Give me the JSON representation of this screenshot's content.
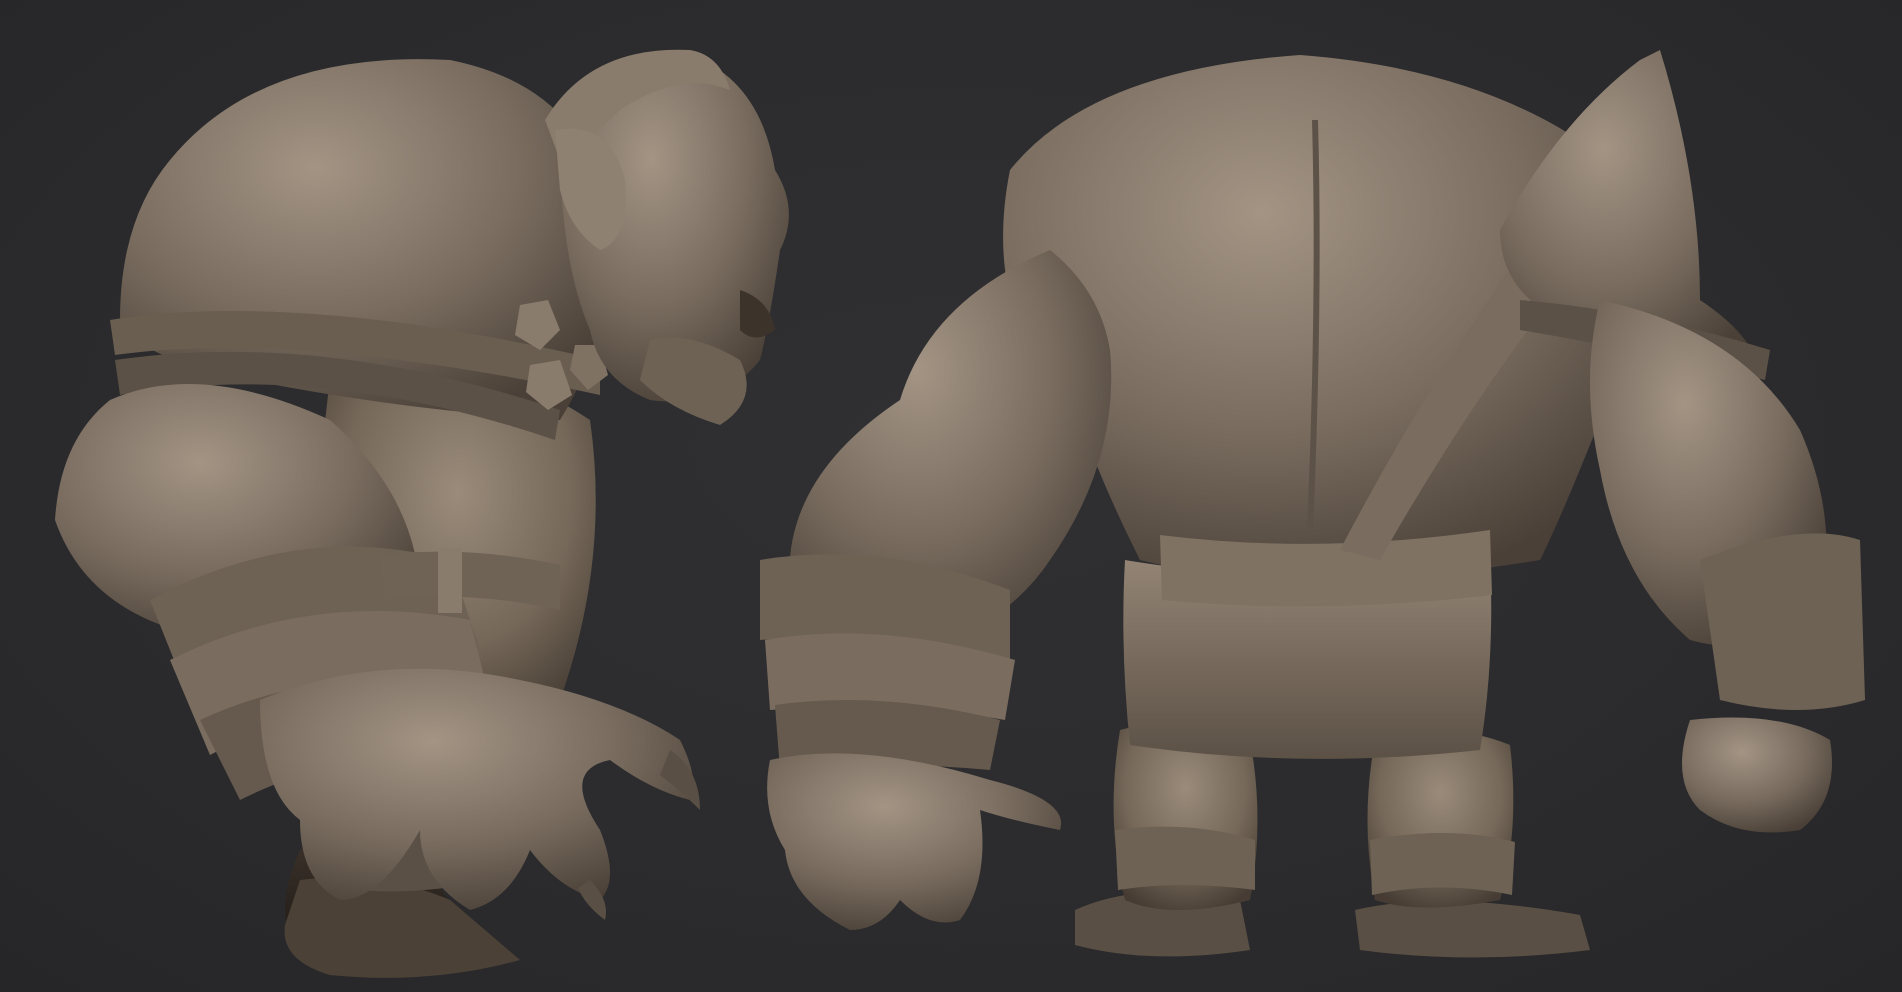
{
  "scene": {
    "background_color": "#2c2c2e",
    "clay_color": "#7a6d60",
    "clay_highlight": "#a39484",
    "clay_shadow": "#3d342c",
    "views": [
      {
        "id": "side",
        "content": "sculpt-side-view"
      },
      {
        "id": "back",
        "content": "sculpt-back-view"
      }
    ]
  }
}
